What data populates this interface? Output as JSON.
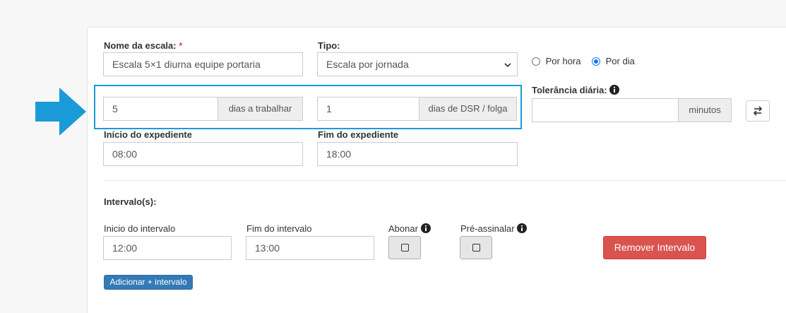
{
  "form": {
    "nome_label": "Nome da escala:",
    "required_mark": "*",
    "nome_value": "Escala 5×1 diurna equipe portaria",
    "tipo_label": "Tipo:",
    "tipo_selected": "Escala por jornada",
    "radio_por_hora": "Por hora",
    "radio_por_dia": "Por dia",
    "radio_selected": "Por dia",
    "dias_trabalhar_value": "5",
    "dias_trabalhar_addon": "dias a trabalhar",
    "dias_folga_value": "1",
    "dias_folga_addon": "dias de DSR / folga",
    "tolerancia_label": "Tolerância diária:",
    "tolerancia_value": "",
    "tolerancia_addon": "minutos",
    "inicio_label": "Início do expediente",
    "inicio_value": "08:00",
    "fim_label": "Fim do expediente",
    "fim_value": "18:00"
  },
  "intervalos": {
    "section_label": "Intervalo(s):",
    "inicio_label": "Inicio do intervalo",
    "inicio_value": "12:00",
    "fim_label": "Fim do intervalo",
    "fim_value": "13:00",
    "abonar_label": "Abonar",
    "abonar_checked": false,
    "pre_assinalar_label": "Pré-assinalar",
    "pre_assinalar_checked": false,
    "remover_button": "Remover Intervalo",
    "adicionar_button": "Adicionar + intervalo"
  },
  "icons": {
    "info": "info-circle-icon",
    "swap": "swap-arrows-icon",
    "annotation": "arrow-right-icon",
    "select": "chevron-down-icon"
  },
  "colors": {
    "highlight": "#1a9bd7",
    "danger": "#d9534f",
    "primary": "#337ab7",
    "radio": "#1a73e8",
    "required": "#d9534f"
  }
}
